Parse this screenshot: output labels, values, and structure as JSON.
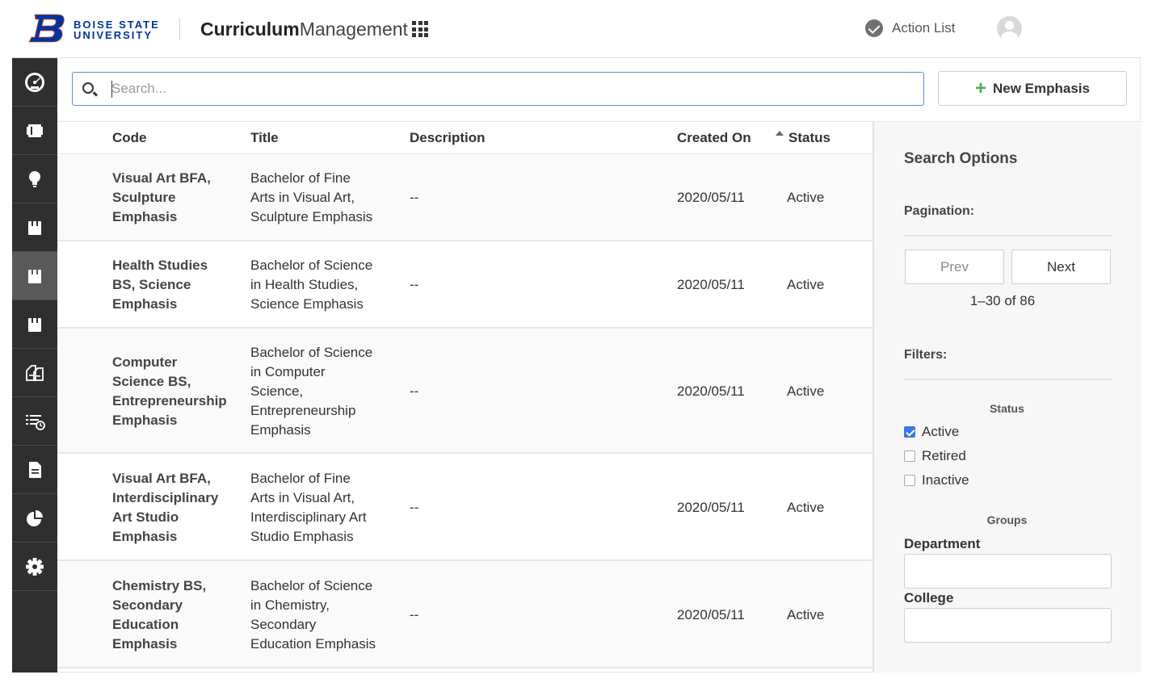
{
  "header": {
    "logo_line1": "BOISE STATE",
    "logo_line2": "UNIVERSITY",
    "app_title_bold": "Curriculum",
    "app_title_light": "Management",
    "action_list": "Action List"
  },
  "sidebar": {
    "items": [
      {
        "icon": "dashboard-icon"
      },
      {
        "icon": "courses-icon"
      },
      {
        "icon": "lightbulb-icon"
      },
      {
        "icon": "programs-icon"
      },
      {
        "icon": "emphases-icon",
        "active": true
      },
      {
        "icon": "minors-icon"
      },
      {
        "icon": "documents-icon"
      },
      {
        "icon": "list-clock-icon"
      },
      {
        "icon": "file-icon"
      },
      {
        "icon": "reports-pie-icon"
      },
      {
        "icon": "settings-gear-icon"
      }
    ]
  },
  "search": {
    "placeholder": "Search..."
  },
  "toolbar": {
    "new_label": "New Emphasis"
  },
  "table": {
    "headers": {
      "code": "Code",
      "title": "Title",
      "description": "Description",
      "created": "Created On",
      "status": "Status"
    },
    "rows": [
      {
        "code": [
          "Visual Art BFA,",
          "Sculpture",
          "Emphasis"
        ],
        "title": [
          "Bachelor of Fine",
          "Arts in Visual Art,",
          "Sculpture Emphasis"
        ],
        "description": "--",
        "created": "2020/05/11",
        "status": "Active"
      },
      {
        "code": [
          "Health Studies",
          "BS, Science",
          "Emphasis"
        ],
        "title": [
          "Bachelor of Science",
          "in Health Studies,",
          "Science Emphasis"
        ],
        "description": "--",
        "created": "2020/05/11",
        "status": "Active"
      },
      {
        "code": [
          "Computer",
          "Science BS,",
          "Entrepreneurship",
          "Emphasis"
        ],
        "title": [
          "Bachelor of Science",
          "in Computer",
          "Science,",
          "Entrepreneurship",
          "Emphasis"
        ],
        "description": "--",
        "created": "2020/05/11",
        "status": "Active"
      },
      {
        "code": [
          "Visual Art BFA,",
          "Interdisciplinary",
          "Art Studio",
          "Emphasis"
        ],
        "title": [
          "Bachelor of Fine",
          "Arts in Visual Art,",
          "Interdisciplinary Art",
          "Studio Emphasis"
        ],
        "description": "--",
        "created": "2020/05/11",
        "status": "Active"
      },
      {
        "code": [
          "Chemistry BS,",
          "Secondary",
          "Education",
          "Emphasis"
        ],
        "title": [
          "Bachelor of Science",
          "in Chemistry,",
          "Secondary",
          "Education Emphasis"
        ],
        "description": "--",
        "created": "2020/05/11",
        "status": "Active"
      }
    ]
  },
  "panel": {
    "title": "Search Options",
    "pagination_label": "Pagination:",
    "prev_label": "Prev",
    "next_label": "Next",
    "range": "1–30 of 86",
    "filters_label": "Filters:",
    "status_group": "Status",
    "status_options": [
      {
        "label": "Active",
        "checked": true
      },
      {
        "label": "Retired",
        "checked": false
      },
      {
        "label": "Inactive",
        "checked": false
      }
    ],
    "groups_label": "Groups",
    "department_label": "Department",
    "department_value": "",
    "college_label": "College",
    "college_value": ""
  },
  "colors": {
    "brand_blue": "#0033a0",
    "sidebar_bg": "#2f2f2f",
    "accent_green": "#4caf50",
    "checkbox_blue": "#3b78e7",
    "search_border": "#5b8dd6"
  }
}
